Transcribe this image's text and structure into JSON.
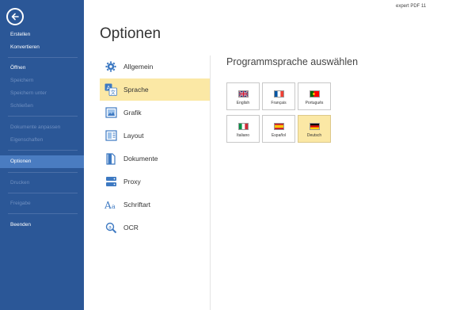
{
  "app_title": "expert PDF 11",
  "sidebar": {
    "items": [
      {
        "label": "Erstellen"
      },
      {
        "label": "Konvertieren"
      },
      {
        "label": "Öffnen"
      },
      {
        "label": "Speichern"
      },
      {
        "label": "Speichern unter"
      },
      {
        "label": "Schließen"
      },
      {
        "label": "Dokumente anpassen"
      },
      {
        "label": "Eigenschaften"
      },
      {
        "label": "Optionen"
      },
      {
        "label": "Drucken"
      },
      {
        "label": "Freigabe"
      },
      {
        "label": "Beenden"
      }
    ]
  },
  "page_title": "Optionen",
  "categories": [
    {
      "label": "Allgemein",
      "icon": "gear-icon"
    },
    {
      "label": "Sprache",
      "icon": "language-icon"
    },
    {
      "label": "Grafik",
      "icon": "image-icon"
    },
    {
      "label": "Layout",
      "icon": "layout-icon"
    },
    {
      "label": "Dokumente",
      "icon": "document-icon"
    },
    {
      "label": "Proxy",
      "icon": "network-icon"
    },
    {
      "label": "Schriftart",
      "icon": "font-icon"
    },
    {
      "label": "OCR",
      "icon": "ocr-icon"
    }
  ],
  "selected_category": "Sprache",
  "language_panel": {
    "title": "Programmsprache auswählen",
    "languages": [
      {
        "label": "English"
      },
      {
        "label": "Français"
      },
      {
        "label": "Português"
      },
      {
        "label": "Italiano"
      },
      {
        "label": "Español"
      },
      {
        "label": "Deutsch"
      }
    ],
    "selected": "Deutsch"
  },
  "colors": {
    "sidebar_bg": "#2b5797",
    "active_item": "#4a7cc1",
    "selection_highlight": "#fbe8a5"
  }
}
